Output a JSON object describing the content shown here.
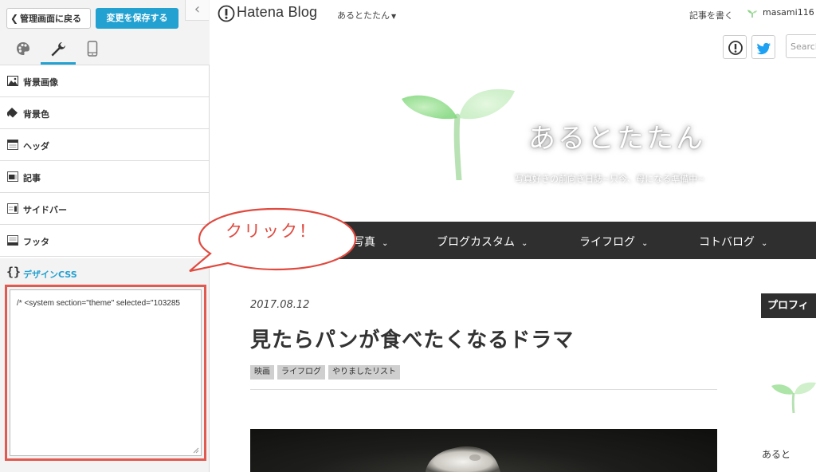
{
  "panel": {
    "back_label": "管理画面に戻る",
    "save_label": "変更を保存する",
    "collapse_symbol": "‹",
    "tabs": [
      "palette-icon",
      "wrench-icon",
      "smartphone-icon"
    ],
    "items": [
      {
        "label": "背景画像"
      },
      {
        "label": "背景色"
      },
      {
        "label": "ヘッダ"
      },
      {
        "label": "記事"
      },
      {
        "label": "サイドバー"
      },
      {
        "label": "フッタ"
      }
    ],
    "css_section": {
      "brace": "{}",
      "label": "デザインCSS",
      "editor_value": "/* <system section=\"theme\" selected=\"103285"
    },
    "accent_color": "#23a1d1",
    "highlight_color": "#e15a4f"
  },
  "topbar": {
    "logo_text": "Hatena Blog",
    "blog_switch": "あるとたたん",
    "write_link": "記事を書く",
    "username": "masami116"
  },
  "header": {
    "title": "あるとたたん",
    "subtitle": "写真好きの前向き日誌~只今、母になる準備中~",
    "search_placeholder": "Search"
  },
  "nav": {
    "items": [
      "写真",
      "ブログカスタム",
      "ライフログ",
      "コトバログ"
    ]
  },
  "callout": {
    "text": "クリック！"
  },
  "article": {
    "date": "2017.08.12",
    "title": "見たらパンが食べたくなるドラマ",
    "tags": [
      "映画",
      "ライフログ",
      "やりましたリスト"
    ]
  },
  "sidebar": {
    "heading": "プロフィ",
    "name": "あると"
  }
}
